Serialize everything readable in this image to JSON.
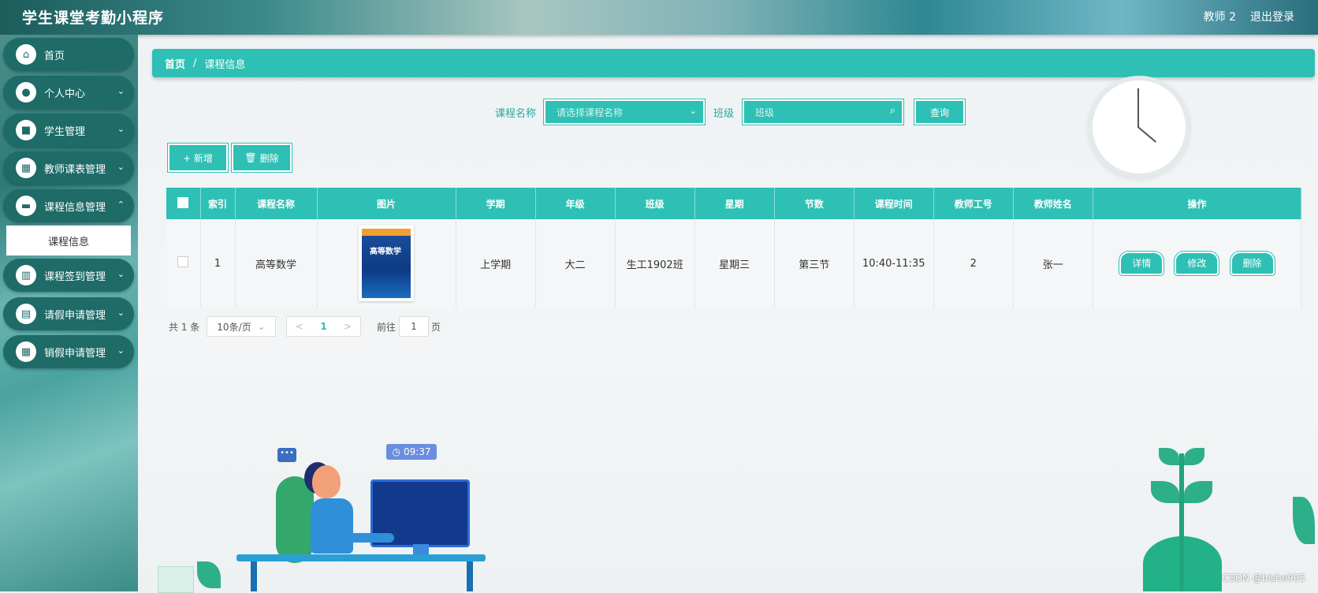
{
  "header": {
    "app_title": "学生课堂考勤小程序",
    "user": "教师 2",
    "logout": "退出登录"
  },
  "sidebar": {
    "items": [
      {
        "label": "首页",
        "icon": "home-icon"
      },
      {
        "label": "个人中心",
        "icon": "user-icon"
      },
      {
        "label": "学生管理",
        "icon": "briefcase-icon"
      },
      {
        "label": "教师课表管理",
        "icon": "grid-icon"
      },
      {
        "label": "课程信息管理",
        "icon": "monitor-icon"
      },
      {
        "label": "课程签到管理",
        "icon": "book-icon"
      },
      {
        "label": "请假申请管理",
        "icon": "clipboard-icon"
      },
      {
        "label": "销假申请管理",
        "icon": "grid-icon"
      }
    ],
    "submenu": {
      "label": "课程信息"
    }
  },
  "breadcrumb": {
    "home": "首页",
    "sep": "/",
    "current": "课程信息"
  },
  "search": {
    "course_label": "课程名称",
    "course_placeholder": "请选择课程名称",
    "class_label": "班级",
    "class_placeholder": "班级",
    "query_button": "查询"
  },
  "toolbar": {
    "add": "+ 新增",
    "delete": "删除"
  },
  "table": {
    "headers": [
      "索引",
      "课程名称",
      "图片",
      "学期",
      "年级",
      "班级",
      "星期",
      "节数",
      "课程时间",
      "教师工号",
      "教师姓名",
      "操作"
    ],
    "rows": [
      {
        "index": "1",
        "course": "高等数学",
        "image_title": "高等数学",
        "term": "上学期",
        "grade": "大二",
        "class": "生工1902班",
        "weekday": "星期三",
        "period": "第三节",
        "time": "10:40-11:35",
        "teacher_id": "2",
        "teacher_name": "张一"
      }
    ],
    "actions": {
      "detail": "详情",
      "edit": "修改",
      "delete": "删除"
    }
  },
  "pagination": {
    "total": "共 1 条",
    "page_size": "10条/页",
    "prev": "<",
    "current": "1",
    "next": ">",
    "goto_label": "前往",
    "goto_value": "1",
    "page_suffix": "页"
  },
  "decor": {
    "time_badge": "09:37",
    "chat_bubble": "•••"
  },
  "watermark": "CSDN @bishe905",
  "colors": {
    "accent": "#2ec0b5",
    "sidebar_button": "#1e6b68"
  }
}
